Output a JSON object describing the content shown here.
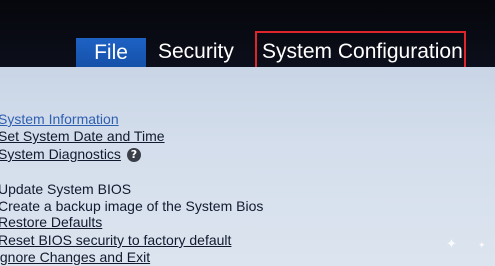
{
  "menu": {
    "tabs": [
      {
        "label": "File",
        "active": true
      },
      {
        "label": "Security",
        "active": false
      },
      {
        "label": "System Configuration",
        "active": false,
        "highlighted": true
      }
    ]
  },
  "items": [
    {
      "label": "System Information"
    },
    {
      "label": "Set System Date and Time"
    },
    {
      "label": "System Diagnostics"
    },
    {
      "label": "Update System BIOS"
    },
    {
      "label": "Create a backup image of the System Bios"
    },
    {
      "label": "Restore Defaults"
    },
    {
      "label": "Reset BIOS security to factory default"
    },
    {
      "label": "Ignore Changes and Exit"
    }
  ],
  "help_icon": {
    "glyph": "?"
  },
  "colors": {
    "active_tab": "#1a5ab8",
    "highlight_border": "#e0242b",
    "link_blue": "#2f5fb0",
    "panel_bg": "#d0dbe9"
  }
}
